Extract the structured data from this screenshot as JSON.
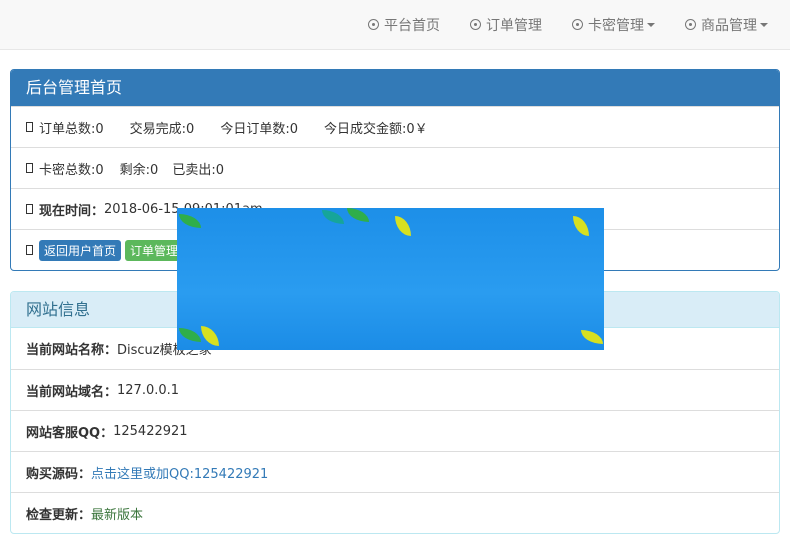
{
  "nav": {
    "items": [
      {
        "label": "平台首页",
        "dropdown": false
      },
      {
        "label": "订单管理",
        "dropdown": false
      },
      {
        "label": "卡密管理",
        "dropdown": true
      },
      {
        "label": "商品管理",
        "dropdown": true
      }
    ]
  },
  "admin": {
    "title": "后台管理首页",
    "stats1": [
      "订单总数:0",
      "交易完成:0",
      "今日订单数:0",
      "今日成交金额:0￥"
    ],
    "stats2": [
      "卡密总数:0",
      "剩余:0",
      "已卖出:0"
    ],
    "time_label": "现在时间：",
    "time_value": "2018-06-15 09:01:01am",
    "buttons": [
      "返回用户首页",
      "订单管理"
    ]
  },
  "site": {
    "title": "网站信息",
    "name_label": "当前网站名称：",
    "name_value": "Discuz模板之家",
    "domain_label": "当前网站域名：",
    "domain_value": "127.0.0.1",
    "qq_label": "网站客服QQ：",
    "qq_value": "125422921",
    "buy_label": "购买源码：",
    "buy_link": "点击这里或加QQ:125422921",
    "update_label": "检查更新：",
    "update_value": "最新版本"
  },
  "colors": {
    "primary": "#337ab7",
    "success": "#5cb85c",
    "info_bg": "#d9edf7"
  }
}
